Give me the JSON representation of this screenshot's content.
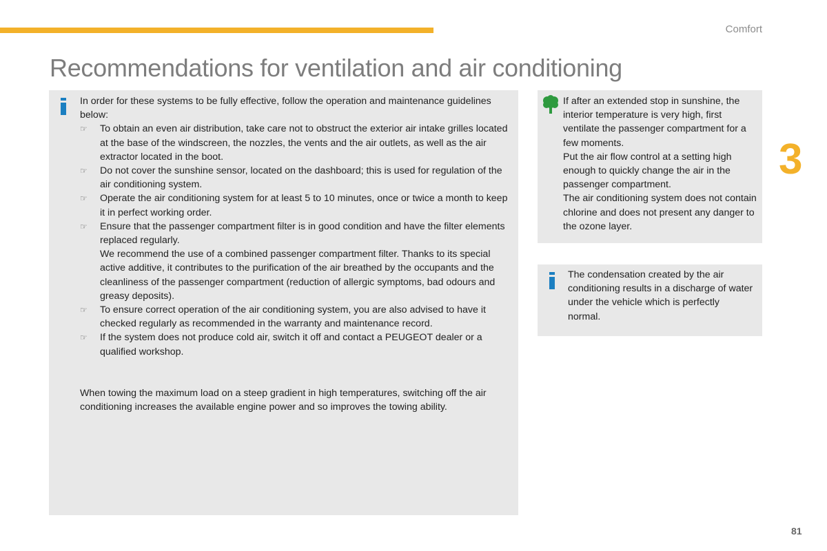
{
  "header": {
    "section": "Comfort",
    "title": "Recommendations for ventilation and air conditioning",
    "accent_color": "#f3b12a"
  },
  "main_panel": {
    "icon": "info-icon",
    "intro": "In order for these systems to be fully effective, follow the operation and maintenance guidelines below:",
    "bullet_icon": "pointing-hand-icon",
    "bullets": [
      {
        "text": "To obtain an even air distribution, take care not to obstruct the exterior air intake grilles located at the base of the windscreen, the nozzles, the vents and the air outlets, as well as the air extractor located in the boot."
      },
      {
        "text": "Do not cover the sunshine sensor, located on the dashboard; this is used for regulation of the air conditioning system."
      },
      {
        "text": "Operate the air conditioning system for at least 5 to 10 minutes, once or twice a month to keep it in perfect working order."
      },
      {
        "text": "Ensure that the passenger compartment filter is in good condition and have the filter elements replaced regularly.",
        "extra": "We recommend the use of a combined passenger compartment filter. Thanks to its special active additive, it contributes to the purification of the air breathed by the occupants and the cleanliness of the passenger compartment (reduction of allergic symptoms, bad odours and greasy deposits)."
      },
      {
        "text": "To ensure correct operation of the air conditioning system, you are also advised to have it checked regularly as recommended in the warranty and maintenance record."
      },
      {
        "text": "If the system does not produce cold air, switch it off and contact a PEUGEOT dealer or a qualified workshop."
      }
    ],
    "towing_note": "When towing the maximum load on a steep gradient in high temperatures, switching off the air conditioning increases the available engine power and so improves the towing ability."
  },
  "eco_panel": {
    "icon": "tree-icon",
    "paragraphs": [
      "If after an extended stop in sunshine, the interior temperature is very high, first ventilate the passenger compartment for a few moments.",
      "Put the air flow control at a setting high enough to quickly change the air in the passenger compartment.",
      "The air conditioning system does not contain chlorine and does not present any danger to the ozone layer."
    ]
  },
  "info_panel": {
    "icon": "info-icon",
    "text": "The condensation created by the air conditioning results in a discharge of water under the vehicle which is perfectly normal."
  },
  "chapter_number": "3",
  "page_number": "81"
}
